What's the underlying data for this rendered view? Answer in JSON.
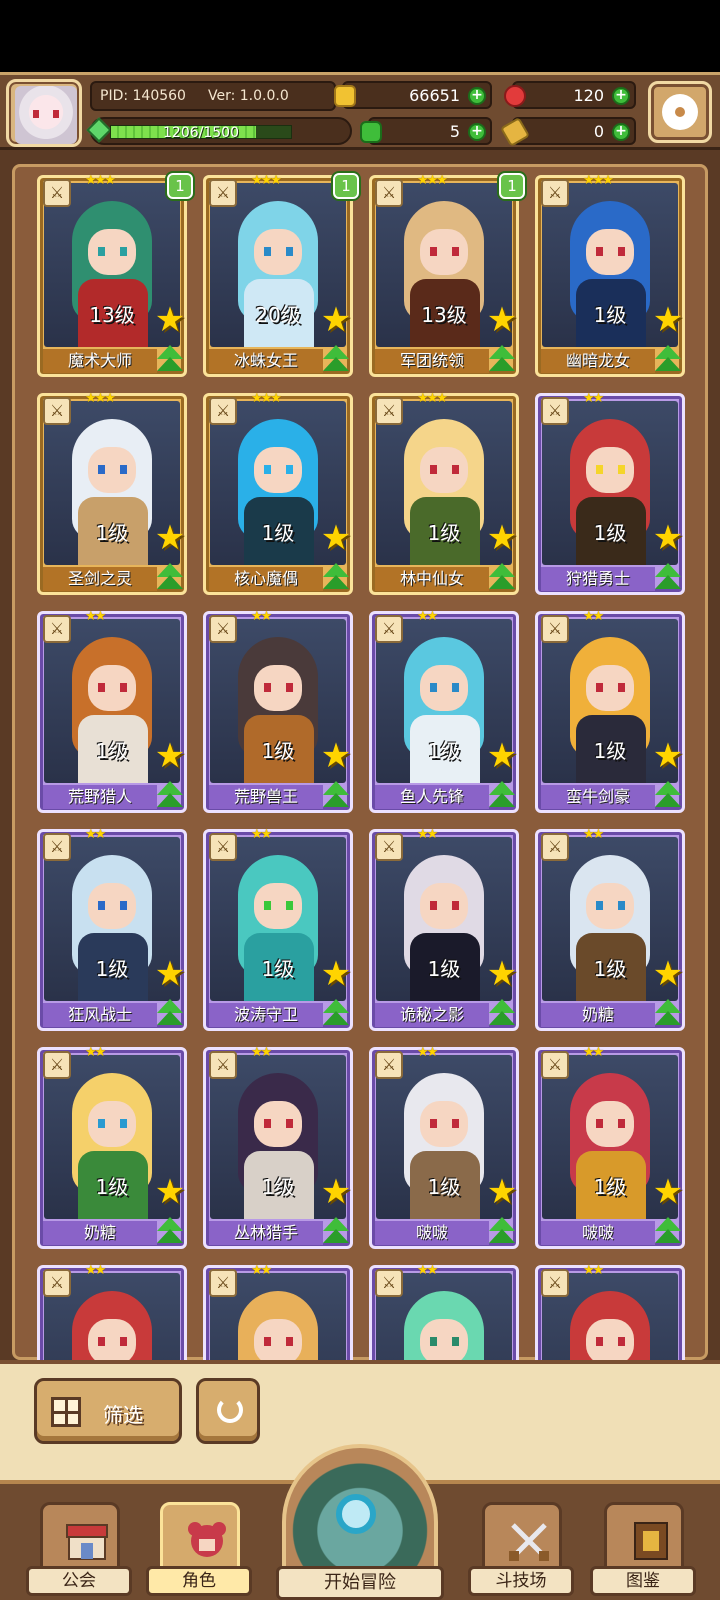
{
  "header": {
    "pid_text": "PID: 140560",
    "version_text": "Ver: 1.0.0.0",
    "exp_text": "1206/1500",
    "exp_progress": 0.804,
    "resources": {
      "gold": "66651",
      "apple": "120",
      "clover": "5",
      "tag": "0"
    }
  },
  "cards": [
    {
      "name": "魔术大师",
      "level": "13级",
      "stars": "★★★",
      "rarity": "gold",
      "badge": "1",
      "hair": "#2f8f70",
      "eye": "#2aa0a0",
      "body": "#b22a2a"
    },
    {
      "name": "冰蛛女王",
      "level": "20级",
      "stars": "★★★",
      "rarity": "gold",
      "badge": "1",
      "hair": "#7fd4e8",
      "eye": "#2a8ac8",
      "body": "#cfe8f5"
    },
    {
      "name": "军团统领",
      "level": "13级",
      "stars": "★★★",
      "rarity": "gold",
      "badge": "1",
      "hair": "#e0b982",
      "eye": "#c02a3a",
      "body": "#5a2a1a"
    },
    {
      "name": "幽暗龙女",
      "level": "1级",
      "stars": "★★★",
      "rarity": "gold",
      "badge": "",
      "hair": "#2a6ac8",
      "eye": "#c02a3a",
      "body": "#1a2f5a"
    },
    {
      "name": "圣剑之灵",
      "level": "1级",
      "stars": "★★★",
      "rarity": "gold",
      "badge": "",
      "hair": "#e8eef5",
      "eye": "#2a6ac8",
      "body": "#c8a06a"
    },
    {
      "name": "核心魔偶",
      "level": "1级",
      "stars": "★★★",
      "rarity": "gold",
      "badge": "",
      "hair": "#2ab0e8",
      "eye": "#2ab0e8",
      "body": "#1a3a4a"
    },
    {
      "name": "林中仙女",
      "level": "1级",
      "stars": "★★★",
      "rarity": "gold",
      "badge": "",
      "hair": "#f5d58a",
      "eye": "#c02a3a",
      "body": "#4a6a2a"
    },
    {
      "name": "狩猎勇士",
      "level": "1级",
      "stars": "★★",
      "rarity": "purple",
      "badge": "",
      "hair": "#c83a3a",
      "eye": "#f5d52a",
      "body": "#3a2a1a"
    },
    {
      "name": "荒野猎人",
      "level": "1级",
      "stars": "★★",
      "rarity": "purple",
      "badge": "",
      "hair": "#c8702a",
      "eye": "#c02a3a",
      "body": "#e8e0d5"
    },
    {
      "name": "荒野兽王",
      "level": "1级",
      "stars": "★★",
      "rarity": "purple",
      "badge": "",
      "hair": "#4a3a3a",
      "eye": "#c02a3a",
      "body": "#b06a2a"
    },
    {
      "name": "鱼人先锋",
      "level": "1级",
      "stars": "★★",
      "rarity": "purple",
      "badge": "",
      "hair": "#5ac8e0",
      "eye": "#2a8ac8",
      "body": "#e8f0f5"
    },
    {
      "name": "蛮牛剑豪",
      "level": "1级",
      "stars": "★★",
      "rarity": "purple",
      "badge": "",
      "hair": "#f0b03a",
      "eye": "#c02a3a",
      "body": "#2a2a3a"
    },
    {
      "name": "狂风战士",
      "level": "1级",
      "stars": "★★",
      "rarity": "purple",
      "badge": "",
      "hair": "#c8e0f0",
      "eye": "#2a6ac8",
      "body": "#2a3a5a"
    },
    {
      "name": "波涛守卫",
      "level": "1级",
      "stars": "★★",
      "rarity": "purple",
      "badge": "",
      "hair": "#4ac8c0",
      "eye": "#3ac83a",
      "body": "#2aa0a0"
    },
    {
      "name": "诡秘之影",
      "level": "1级",
      "stars": "★★",
      "rarity": "purple",
      "badge": "",
      "hair": "#e0dae5",
      "eye": "#c02a3a",
      "body": "#1a1a2a"
    },
    {
      "name": "奶糖",
      "level": "1级",
      "stars": "★★",
      "rarity": "purple",
      "badge": "",
      "hair": "#dae5f0",
      "eye": "#2a8ac8",
      "body": "#6a4a2a"
    },
    {
      "name": "奶糖",
      "level": "1级",
      "stars": "★★",
      "rarity": "purple",
      "badge": "",
      "hair": "#f5d06a",
      "eye": "#2a9ad0",
      "body": "#3a8a3a"
    },
    {
      "name": "丛林猎手",
      "level": "1级",
      "stars": "★★",
      "rarity": "purple",
      "badge": "",
      "hair": "#3a2a4a",
      "eye": "#c02a3a",
      "body": "#d8d0c8"
    },
    {
      "name": "啵啵",
      "level": "1级",
      "stars": "★★",
      "rarity": "purple",
      "badge": "",
      "hair": "#e8e8ee",
      "eye": "#c02a3a",
      "body": "#8a6a4a"
    },
    {
      "name": "啵啵",
      "level": "1级",
      "stars": "★★",
      "rarity": "purple",
      "badge": "",
      "hair": "#c83a4a",
      "eye": "#c02a3a",
      "body": "#d89a2a"
    },
    {
      "name": "",
      "level": "",
      "stars": "★★",
      "rarity": "purple",
      "badge": "",
      "hair": "#c83a3a",
      "eye": "#c02a3a",
      "body": "#6a2a2a"
    },
    {
      "name": "",
      "level": "",
      "stars": "★★",
      "rarity": "purple",
      "badge": "",
      "hair": "#e8b05a",
      "eye": "#c02a3a",
      "body": "#b07a3a"
    },
    {
      "name": "",
      "level": "",
      "stars": "★★",
      "rarity": "purple",
      "badge": "",
      "hair": "#6ad8b0",
      "eye": "#2a8a6a",
      "body": "#3a8a6a"
    },
    {
      "name": "",
      "level": "",
      "stars": "★★",
      "rarity": "purple",
      "badge": "",
      "hair": "#c83a3a",
      "eye": "#c02a3a",
      "body": "#3a3a3a"
    }
  ],
  "controls": {
    "filter_label": "筛选",
    "refresh_icon": "refresh-icon"
  },
  "nav": {
    "guild": "公会",
    "character": "角色",
    "adventure": "开始冒险",
    "arena": "斗技场",
    "codex": "图鉴",
    "active": "character"
  }
}
